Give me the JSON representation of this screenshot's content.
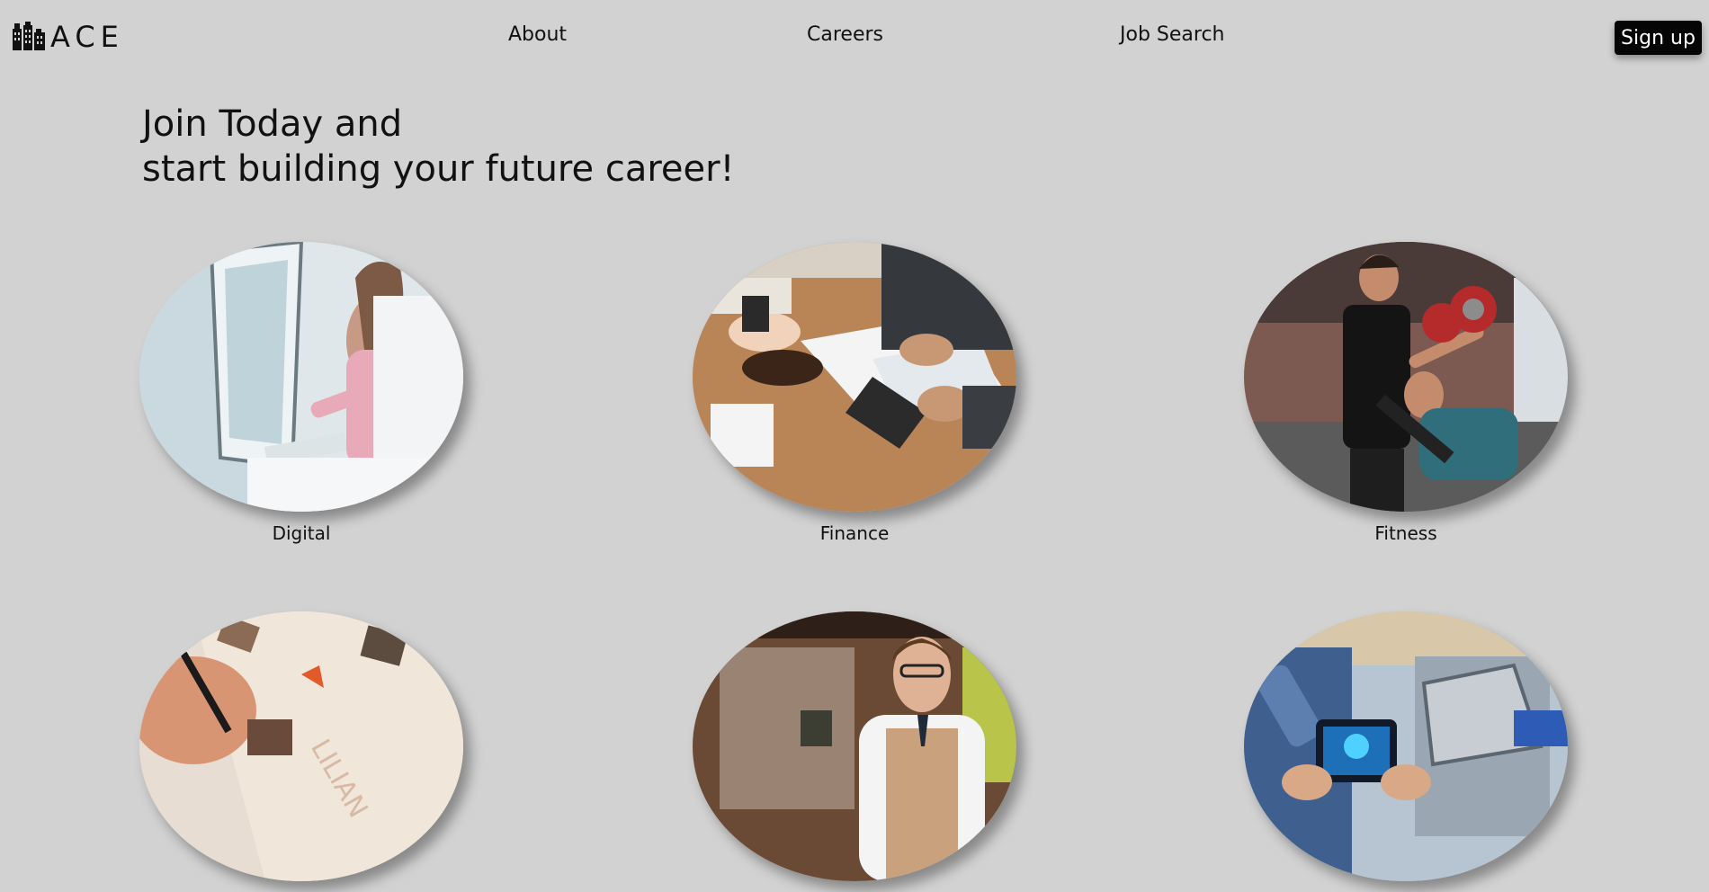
{
  "brand": {
    "name": "ACE",
    "icon": "building-icon"
  },
  "nav": {
    "about": "About",
    "careers": "Careers",
    "job_search": "Job Search",
    "signup": "Sign up"
  },
  "hero": {
    "line1": "Join Today and",
    "line2": "start building your future career!"
  },
  "categories": [
    {
      "label": "Digital",
      "image": "office-computer-photo"
    },
    {
      "label": "Finance",
      "image": "finance-meeting-photo"
    },
    {
      "label": "Fitness",
      "image": "gym-trainer-photo"
    },
    {
      "label": "",
      "image": "design-sketch-photo"
    },
    {
      "label": "",
      "image": "waiter-photo"
    },
    {
      "label": "",
      "image": "robotics-factory-photo"
    }
  ],
  "colors": {
    "background": "#d2d2d2",
    "button": "#050505",
    "button_text": "#ffffff"
  }
}
